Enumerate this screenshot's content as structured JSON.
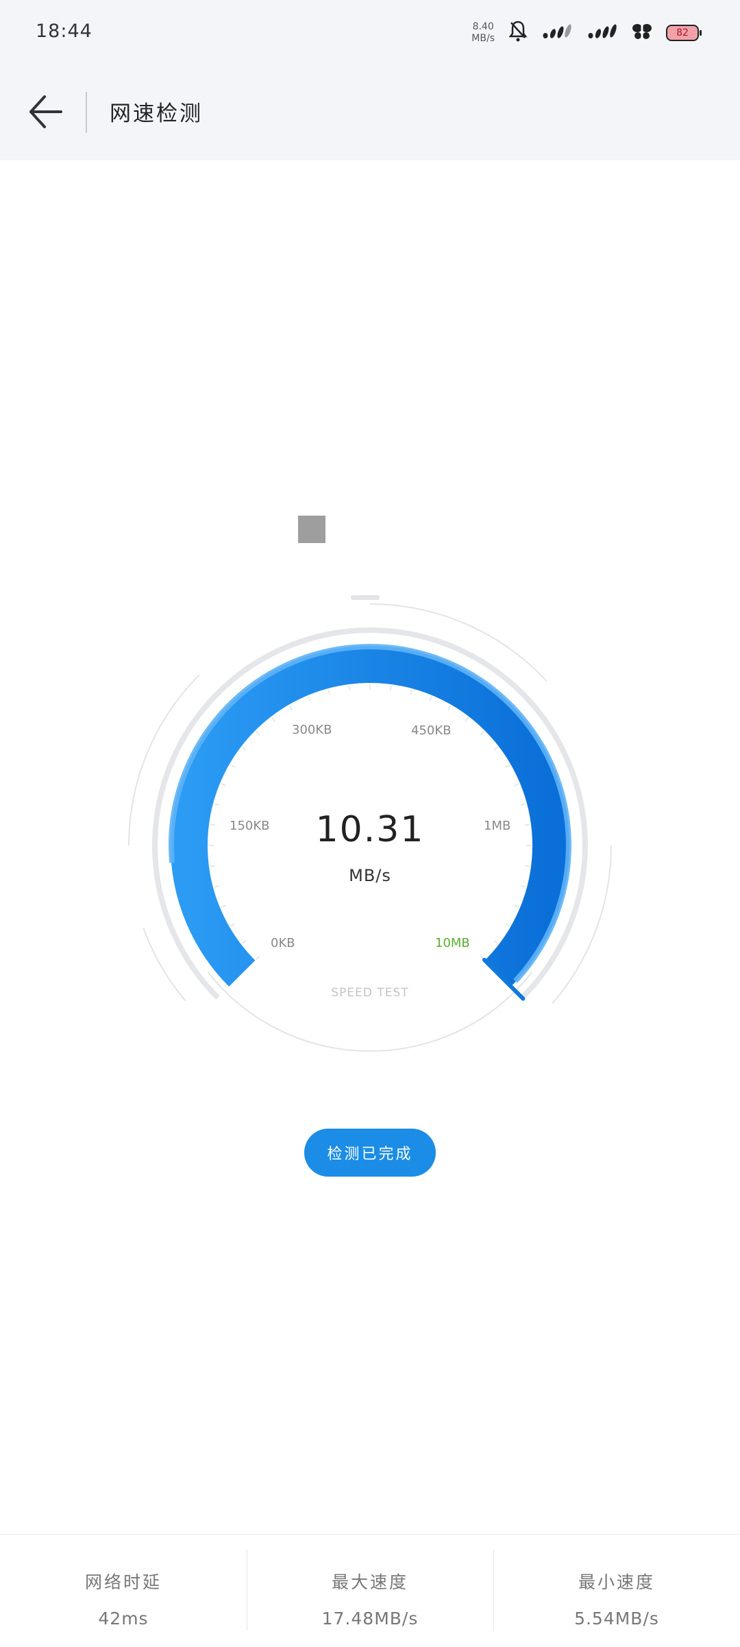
{
  "status_bar": {
    "time": "18:44",
    "net_speed_value": "8.40",
    "net_speed_unit": "MB/s",
    "battery": "82",
    "icons": [
      "bell-off-icon",
      "signal-icon",
      "signal-icon",
      "butterfly-icon",
      "battery-icon"
    ]
  },
  "header": {
    "title": "网速检测",
    "back_icon": "arrow-left-icon"
  },
  "gauge": {
    "speed_value": "10.31",
    "speed_unit": "MB/s",
    "progress_fraction": 1.0,
    "ticks": [
      "0KB",
      "150KB",
      "300KB",
      "450KB",
      "1MB",
      "10MB"
    ],
    "active_tick": "10MB",
    "speed_test_label": "SPEED TEST",
    "colors": {
      "arc_start": "#2b9bf4",
      "arc_end": "#0a6fd8",
      "track": "#e4e6ea",
      "accent_tick": "#5aac2e"
    }
  },
  "done_button": {
    "label": "检测已完成",
    "color": "#1b8de6"
  },
  "stats": [
    {
      "label": "网络时延",
      "value": "42ms"
    },
    {
      "label": "最大速度",
      "value": "17.48MB/s"
    },
    {
      "label": "最小速度",
      "value": "5.54MB/s"
    }
  ]
}
